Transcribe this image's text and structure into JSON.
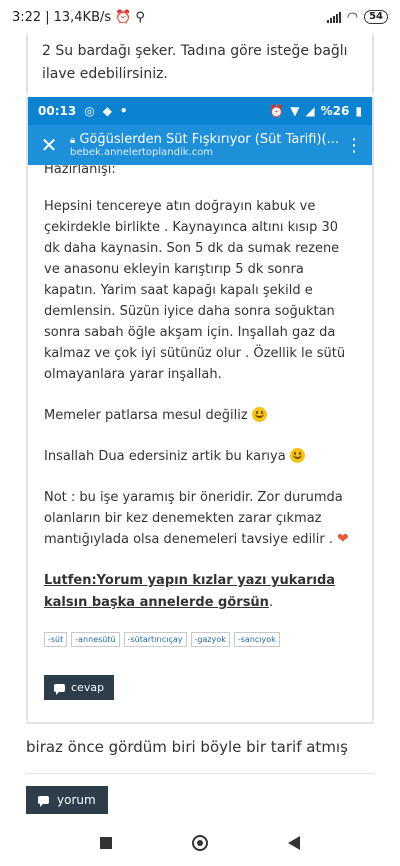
{
  "status_bar": {
    "time": "3:22",
    "speed": "13,4KB/s",
    "battery": "54"
  },
  "top_text": "2 Su bardağı şeker.  Tadına göre isteğe bağlı ilave edebilirsiniz.",
  "inner": {
    "status": {
      "time": "00:13",
      "battery": "%26"
    },
    "toolbar": {
      "title": "Göğüslerden Süt Fışkırıyor (Süt Tarifi)(...",
      "url": "bebek.annelertoplandik.com"
    },
    "article": {
      "heading": "Hazırlanışı:",
      "paragraph": "Hepsini tencereye atın doğrayın kabuk ve çekirdekle birlikte . Kaynayınca altını kısıp 30 dk daha kaynasin. Son 5 dk da sumak rezene ve anasonu ekleyin karıştırıp 5 dk sonra kapatın. Yarim saat kapağı kapalı şekild e demlensin.  Süzün iyice daha sonra soğuktan sonra sabah öğle akşam için.  Inşallah gaz da kalmaz ve çok iyi sütünüz olur . Özellik le sütü olmayanlara yarar inşallah.",
      "line2": "Memeler patlarsa mesul değiliz",
      "line3": "Insallah Dua edersiniz artik bu karıya",
      "note": "Not : bu işe yaramış bir öneridir.  Zor durumda olanların bir kez denemekten zarar çıkmaz mantığıylada olsa denemeleri tavsiye edilir .",
      "bold_link": "Lutfen:Yorum yapın kızlar yazı yukarıda kalsın başka annelerde görsün",
      "bold_tail": "."
    },
    "tags": [
      "-süt",
      "-annesütü",
      "-sütartırıcıçay",
      "-gazyok",
      "-sancıyok"
    ],
    "reply_label": "cevap"
  },
  "comment_text": "biraz önce gördüm biri böyle bir tarif atmış",
  "comment_button": "yorum"
}
